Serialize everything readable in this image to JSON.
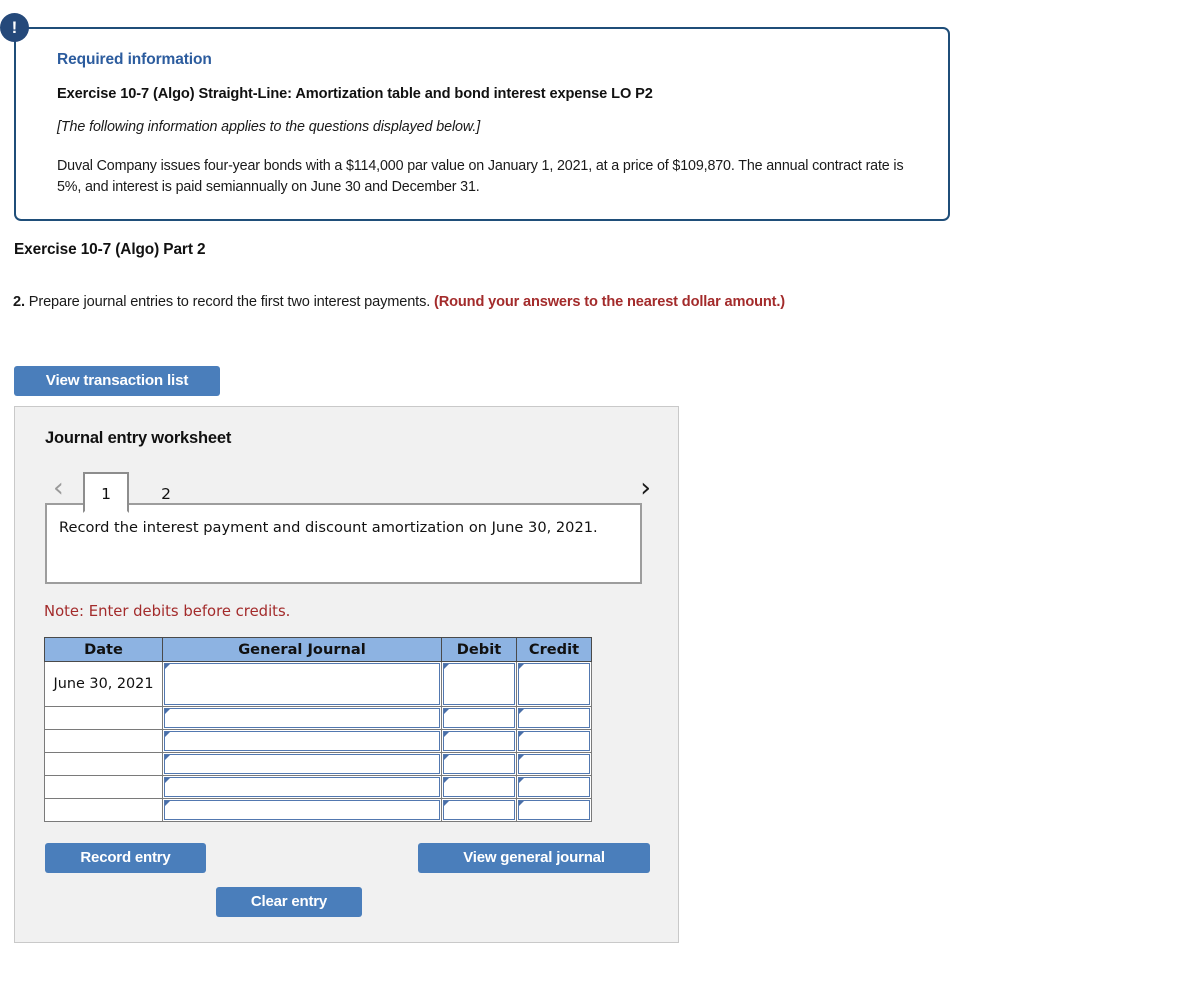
{
  "required_info": {
    "alert_icon": "exclamation-icon",
    "heading": "Required information",
    "exercise_title": "Exercise 10-7 (Algo) Straight-Line: Amortization table and bond interest expense LO P2",
    "applies_note": "[The following information applies to the questions displayed below.]",
    "body": "Duval Company issues four-year bonds with a $114,000 par value on January 1, 2021, at a price of $109,870. The annual contract rate is 5%, and interest is paid semiannually on June 30 and December 31.",
    "border_color": "#1f4e79",
    "heading_color": "#2c5c9e"
  },
  "part": {
    "heading": "Exercise 10-7 (Algo) Part 2",
    "question_number": "2.",
    "question_text": " Prepare journal entries to record the first two interest payments. ",
    "question_emphasis": "(Round your answers to the nearest dollar amount.)",
    "emphasis_color": "#a32b2b"
  },
  "buttons": {
    "view_transaction_list": "View transaction list",
    "record_entry": "Record entry",
    "clear_entry": "Clear entry",
    "view_general_journal": "View general journal",
    "primary_color": "#4a7ebb"
  },
  "worksheet": {
    "title": "Journal entry worksheet",
    "prev_icon": "chevron-left-icon",
    "next_icon": "chevron-right-icon",
    "tabs": [
      {
        "label": "1",
        "active": true
      },
      {
        "label": "2",
        "active": false
      }
    ],
    "description": "Record the interest payment and discount amortization on June 30, 2021.",
    "note": "Note: Enter debits before credits.",
    "note_color": "#a32b2b",
    "table": {
      "header_color": "#8db3e2",
      "columns": [
        "Date",
        "General Journal",
        "Debit",
        "Credit"
      ],
      "rows": [
        {
          "date": "June 30,\n2021",
          "general_journal": "",
          "debit": "",
          "credit": ""
        },
        {
          "date": "",
          "general_journal": "",
          "debit": "",
          "credit": ""
        },
        {
          "date": "",
          "general_journal": "",
          "debit": "",
          "credit": ""
        },
        {
          "date": "",
          "general_journal": "",
          "debit": "",
          "credit": ""
        },
        {
          "date": "",
          "general_journal": "",
          "debit": "",
          "credit": ""
        },
        {
          "date": "",
          "general_journal": "",
          "debit": "",
          "credit": ""
        }
      ]
    }
  }
}
